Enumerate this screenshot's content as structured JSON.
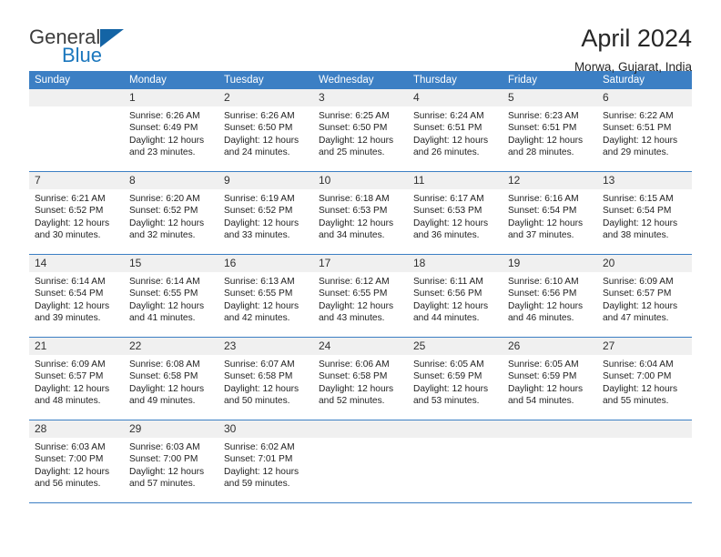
{
  "brand": {
    "line1": "General",
    "line2": "Blue",
    "triangle_color": "#1464a5"
  },
  "header": {
    "month_title": "April 2024",
    "location": "Morwa, Gujarat, India",
    "header_bg": "#3c7fc4"
  },
  "weekday_headers": [
    "Sunday",
    "Monday",
    "Tuesday",
    "Wednesday",
    "Thursday",
    "Friday",
    "Saturday"
  ],
  "weeks": [
    [
      {
        "day": "",
        "blank": true
      },
      {
        "day": "1",
        "sunrise": "Sunrise: 6:26 AM",
        "sunset": "Sunset: 6:49 PM",
        "daylight": "Daylight: 12 hours and 23 minutes."
      },
      {
        "day": "2",
        "sunrise": "Sunrise: 6:26 AM",
        "sunset": "Sunset: 6:50 PM",
        "daylight": "Daylight: 12 hours and 24 minutes."
      },
      {
        "day": "3",
        "sunrise": "Sunrise: 6:25 AM",
        "sunset": "Sunset: 6:50 PM",
        "daylight": "Daylight: 12 hours and 25 minutes."
      },
      {
        "day": "4",
        "sunrise": "Sunrise: 6:24 AM",
        "sunset": "Sunset: 6:51 PM",
        "daylight": "Daylight: 12 hours and 26 minutes."
      },
      {
        "day": "5",
        "sunrise": "Sunrise: 6:23 AM",
        "sunset": "Sunset: 6:51 PM",
        "daylight": "Daylight: 12 hours and 28 minutes."
      },
      {
        "day": "6",
        "sunrise": "Sunrise: 6:22 AM",
        "sunset": "Sunset: 6:51 PM",
        "daylight": "Daylight: 12 hours and 29 minutes."
      }
    ],
    [
      {
        "day": "7",
        "sunrise": "Sunrise: 6:21 AM",
        "sunset": "Sunset: 6:52 PM",
        "daylight": "Daylight: 12 hours and 30 minutes."
      },
      {
        "day": "8",
        "sunrise": "Sunrise: 6:20 AM",
        "sunset": "Sunset: 6:52 PM",
        "daylight": "Daylight: 12 hours and 32 minutes."
      },
      {
        "day": "9",
        "sunrise": "Sunrise: 6:19 AM",
        "sunset": "Sunset: 6:52 PM",
        "daylight": "Daylight: 12 hours and 33 minutes."
      },
      {
        "day": "10",
        "sunrise": "Sunrise: 6:18 AM",
        "sunset": "Sunset: 6:53 PM",
        "daylight": "Daylight: 12 hours and 34 minutes."
      },
      {
        "day": "11",
        "sunrise": "Sunrise: 6:17 AM",
        "sunset": "Sunset: 6:53 PM",
        "daylight": "Daylight: 12 hours and 36 minutes."
      },
      {
        "day": "12",
        "sunrise": "Sunrise: 6:16 AM",
        "sunset": "Sunset: 6:54 PM",
        "daylight": "Daylight: 12 hours and 37 minutes."
      },
      {
        "day": "13",
        "sunrise": "Sunrise: 6:15 AM",
        "sunset": "Sunset: 6:54 PM",
        "daylight": "Daylight: 12 hours and 38 minutes."
      }
    ],
    [
      {
        "day": "14",
        "sunrise": "Sunrise: 6:14 AM",
        "sunset": "Sunset: 6:54 PM",
        "daylight": "Daylight: 12 hours and 39 minutes."
      },
      {
        "day": "15",
        "sunrise": "Sunrise: 6:14 AM",
        "sunset": "Sunset: 6:55 PM",
        "daylight": "Daylight: 12 hours and 41 minutes."
      },
      {
        "day": "16",
        "sunrise": "Sunrise: 6:13 AM",
        "sunset": "Sunset: 6:55 PM",
        "daylight": "Daylight: 12 hours and 42 minutes."
      },
      {
        "day": "17",
        "sunrise": "Sunrise: 6:12 AM",
        "sunset": "Sunset: 6:55 PM",
        "daylight": "Daylight: 12 hours and 43 minutes."
      },
      {
        "day": "18",
        "sunrise": "Sunrise: 6:11 AM",
        "sunset": "Sunset: 6:56 PM",
        "daylight": "Daylight: 12 hours and 44 minutes."
      },
      {
        "day": "19",
        "sunrise": "Sunrise: 6:10 AM",
        "sunset": "Sunset: 6:56 PM",
        "daylight": "Daylight: 12 hours and 46 minutes."
      },
      {
        "day": "20",
        "sunrise": "Sunrise: 6:09 AM",
        "sunset": "Sunset: 6:57 PM",
        "daylight": "Daylight: 12 hours and 47 minutes."
      }
    ],
    [
      {
        "day": "21",
        "sunrise": "Sunrise: 6:09 AM",
        "sunset": "Sunset: 6:57 PM",
        "daylight": "Daylight: 12 hours and 48 minutes."
      },
      {
        "day": "22",
        "sunrise": "Sunrise: 6:08 AM",
        "sunset": "Sunset: 6:58 PM",
        "daylight": "Daylight: 12 hours and 49 minutes."
      },
      {
        "day": "23",
        "sunrise": "Sunrise: 6:07 AM",
        "sunset": "Sunset: 6:58 PM",
        "daylight": "Daylight: 12 hours and 50 minutes."
      },
      {
        "day": "24",
        "sunrise": "Sunrise: 6:06 AM",
        "sunset": "Sunset: 6:58 PM",
        "daylight": "Daylight: 12 hours and 52 minutes."
      },
      {
        "day": "25",
        "sunrise": "Sunrise: 6:05 AM",
        "sunset": "Sunset: 6:59 PM",
        "daylight": "Daylight: 12 hours and 53 minutes."
      },
      {
        "day": "26",
        "sunrise": "Sunrise: 6:05 AM",
        "sunset": "Sunset: 6:59 PM",
        "daylight": "Daylight: 12 hours and 54 minutes."
      },
      {
        "day": "27",
        "sunrise": "Sunrise: 6:04 AM",
        "sunset": "Sunset: 7:00 PM",
        "daylight": "Daylight: 12 hours and 55 minutes."
      }
    ],
    [
      {
        "day": "28",
        "sunrise": "Sunrise: 6:03 AM",
        "sunset": "Sunset: 7:00 PM",
        "daylight": "Daylight: 12 hours and 56 minutes."
      },
      {
        "day": "29",
        "sunrise": "Sunrise: 6:03 AM",
        "sunset": "Sunset: 7:00 PM",
        "daylight": "Daylight: 12 hours and 57 minutes."
      },
      {
        "day": "30",
        "sunrise": "Sunrise: 6:02 AM",
        "sunset": "Sunset: 7:01 PM",
        "daylight": "Daylight: 12 hours and 59 minutes."
      },
      {
        "day": "",
        "blank": true
      },
      {
        "day": "",
        "blank": true
      },
      {
        "day": "",
        "blank": true
      },
      {
        "day": "",
        "blank": true
      }
    ]
  ]
}
